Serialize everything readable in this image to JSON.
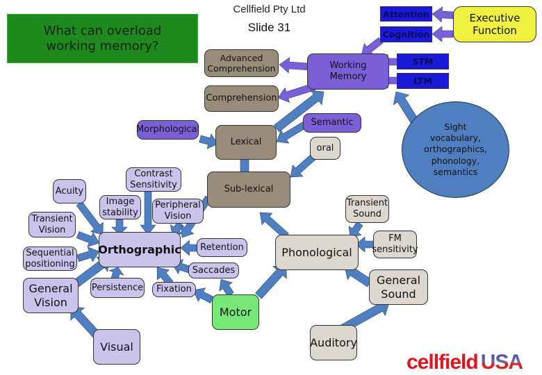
{
  "header": {
    "title": "What can overload\nworking memory?",
    "company": "Cellfield Pty Ltd",
    "slide": "Slide 31"
  },
  "nodes": {
    "attention": "Attention",
    "cognition": "Cognition",
    "executive_function": "Executive\nFunction",
    "stm": "STM",
    "ltm": "LTM",
    "working_memory": "Working\nMemory",
    "advanced_comprehension": "Advanced\nComprehension",
    "comprehension": "Comprehension",
    "morphological": "Morphological",
    "lexical": "Lexical",
    "semantic": "Semantic",
    "oral": "oral",
    "sub_lexical": "Sub-lexical",
    "contrast_sensitivity": "Contrast\nSensitivity",
    "acuity": "Acuity",
    "image_stability": "Image\nstability",
    "peripheral_vision": "Peripheral\nVision",
    "transient_vision": "Transient\nVision",
    "sequential_positioning": "Sequential\npositioning",
    "orthographic": "Orthographic",
    "retention": "Retention",
    "saccades": "Saccades",
    "general_vision": "General\nVision",
    "persistence": "Persistence",
    "fixation": "Fixation",
    "motor": "Motor",
    "visual": "Visual",
    "phonological": "Phonological",
    "transient_sound": "Transient\nSound",
    "fm_sensitivity": "FM\nsensitivity",
    "general_sound": "General\nSound",
    "auditory": "Auditory"
  },
  "callout": "Sight\nvocabulary,\northographics,\nphonology,\nsemantics",
  "logo": {
    "brand": "cellfield",
    "suffix": "USA"
  },
  "colors": {
    "title_bg": "#1e8a1e",
    "tan": "#9a8c7a",
    "purple": "#7b5fd6",
    "lavender": "#cbc3ec",
    "grey": "#dcd8d0",
    "blue": "#1a1ad8",
    "yellow": "#f0f040",
    "motor_green": "#77e877",
    "arrow_blue": "#4f7fc0",
    "arrow_purple": "#7b5fd6"
  }
}
